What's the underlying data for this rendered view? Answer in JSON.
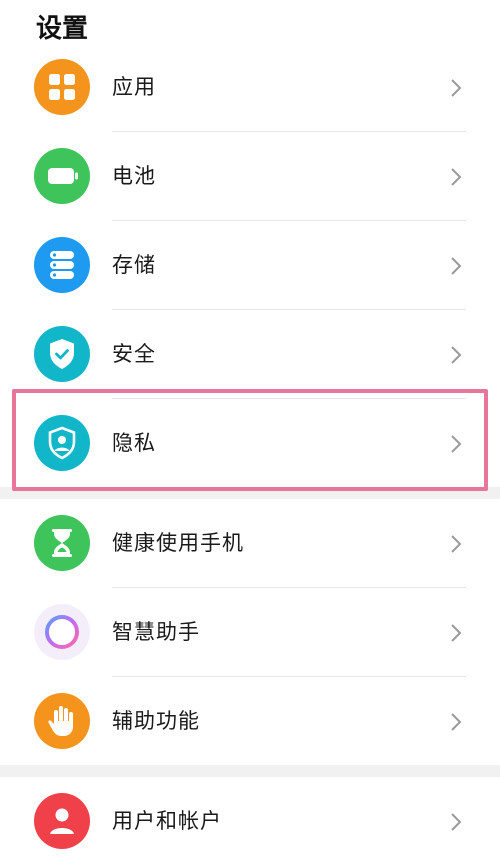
{
  "header": {
    "title": "设置"
  },
  "items": [
    {
      "label": "应用",
      "icon": "apps-grid-icon",
      "color": "#f5941d"
    },
    {
      "label": "电池",
      "icon": "battery-icon",
      "color": "#3ec45a"
    },
    {
      "label": "存储",
      "icon": "storage-icon",
      "color": "#1e9bf0"
    },
    {
      "label": "安全",
      "icon": "shield-check-icon",
      "color": "#11b7c8"
    },
    {
      "label": "隐私",
      "icon": "privacy-shield-icon",
      "color": "#11b7c8"
    },
    {
      "label": "健康使用手机",
      "icon": "hourglass-icon",
      "color": "#3ec45a"
    },
    {
      "label": "智慧助手",
      "icon": "assistant-ring-icon",
      "color": "#b57cf0"
    },
    {
      "label": "辅助功能",
      "icon": "hand-icon",
      "color": "#f5941d"
    },
    {
      "label": "用户和帐户",
      "icon": "user-icon",
      "color": "#f0404a"
    }
  ],
  "highlight_color": "#e8769a"
}
